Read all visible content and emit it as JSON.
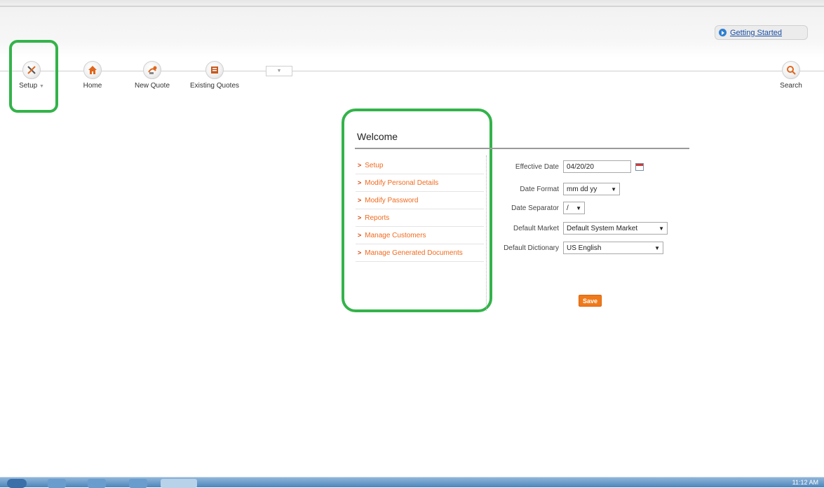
{
  "header": {
    "getting_started": "Getting Started"
  },
  "nav": {
    "setup": "Setup",
    "home": "Home",
    "new_quote": "New Quote",
    "existing_quotes": "Existing Quotes",
    "search": "Search",
    "mini_tab": "▼"
  },
  "welcome": {
    "title": "Welcome",
    "menu": [
      "Setup",
      "Modify Personal Details",
      "Modify Password",
      "Reports",
      "Manage Customers",
      "Manage Generated Documents"
    ]
  },
  "form": {
    "effective_date": {
      "label": "Effective Date",
      "value": "04/20/20"
    },
    "date_format": {
      "label": "Date Format",
      "value": "mm dd yy"
    },
    "date_separator": {
      "label": "Date Separator",
      "value": "/"
    },
    "default_market": {
      "label": "Default Market",
      "value": "Default System Market"
    },
    "default_dictionary": {
      "label": "Default Dictionary",
      "value": "US English"
    },
    "save_label": "Save"
  },
  "taskbar": {
    "clock": "11:12 AM"
  },
  "colors": {
    "accent_orange": "#f06a1e",
    "highlight_green": "#33b34a",
    "link_blue": "#1a4fa3"
  }
}
